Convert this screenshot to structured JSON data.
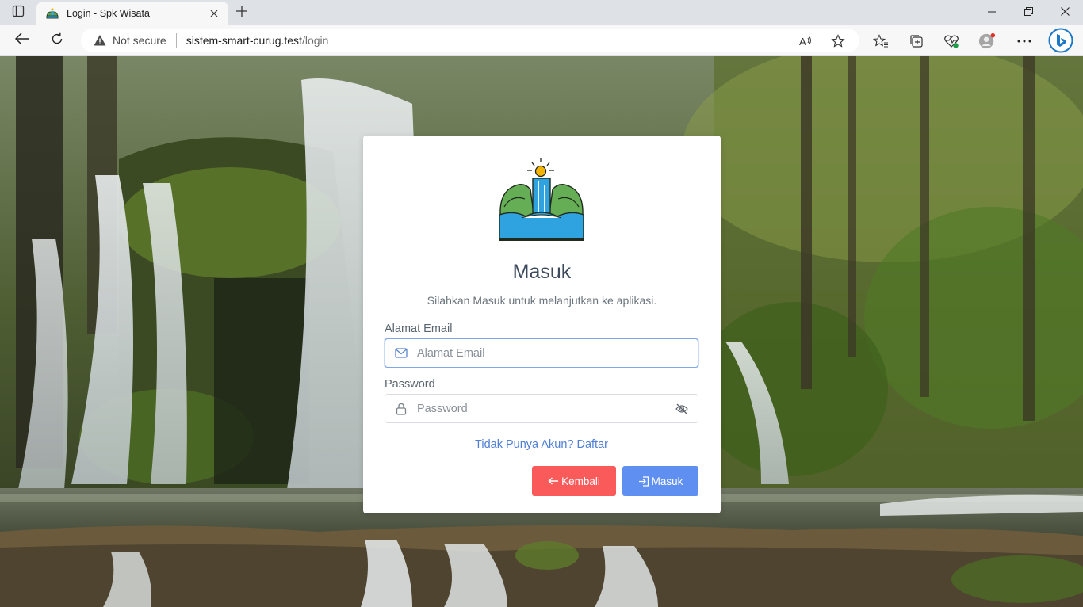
{
  "browser": {
    "tab_title": "Login - Spk Wisata",
    "security_label": "Not secure",
    "url_host": "sistem-smart-curug.test",
    "url_path": "/login"
  },
  "login": {
    "title": "Masuk",
    "subtitle": "Silahkan Masuk untuk melanjutkan ke aplikasi.",
    "email_label": "Alamat Email",
    "email_placeholder": "Alamat Email",
    "password_label": "Password",
    "password_placeholder": "Password",
    "register_link": "Tidak Punya Akun? Daftar",
    "back_button": "Kembali",
    "login_button": "Masuk"
  },
  "colors": {
    "back_button": "#fa5a5a",
    "login_button": "#5f8ff0",
    "link": "#4f7fd6"
  },
  "icons": [
    "sidebar-icon",
    "favicon-icon",
    "close-icon",
    "plus-icon",
    "minimize-icon",
    "restore-icon",
    "back-arrow-icon",
    "refresh-icon",
    "warning-icon",
    "read-aloud-icon",
    "star-icon",
    "favorites-icon",
    "collections-icon",
    "performance-icon",
    "profile-icon",
    "more-icon",
    "bing-icon",
    "mail-icon",
    "lock-icon",
    "eye-off-icon",
    "arrow-left-icon",
    "login-icon"
  ]
}
